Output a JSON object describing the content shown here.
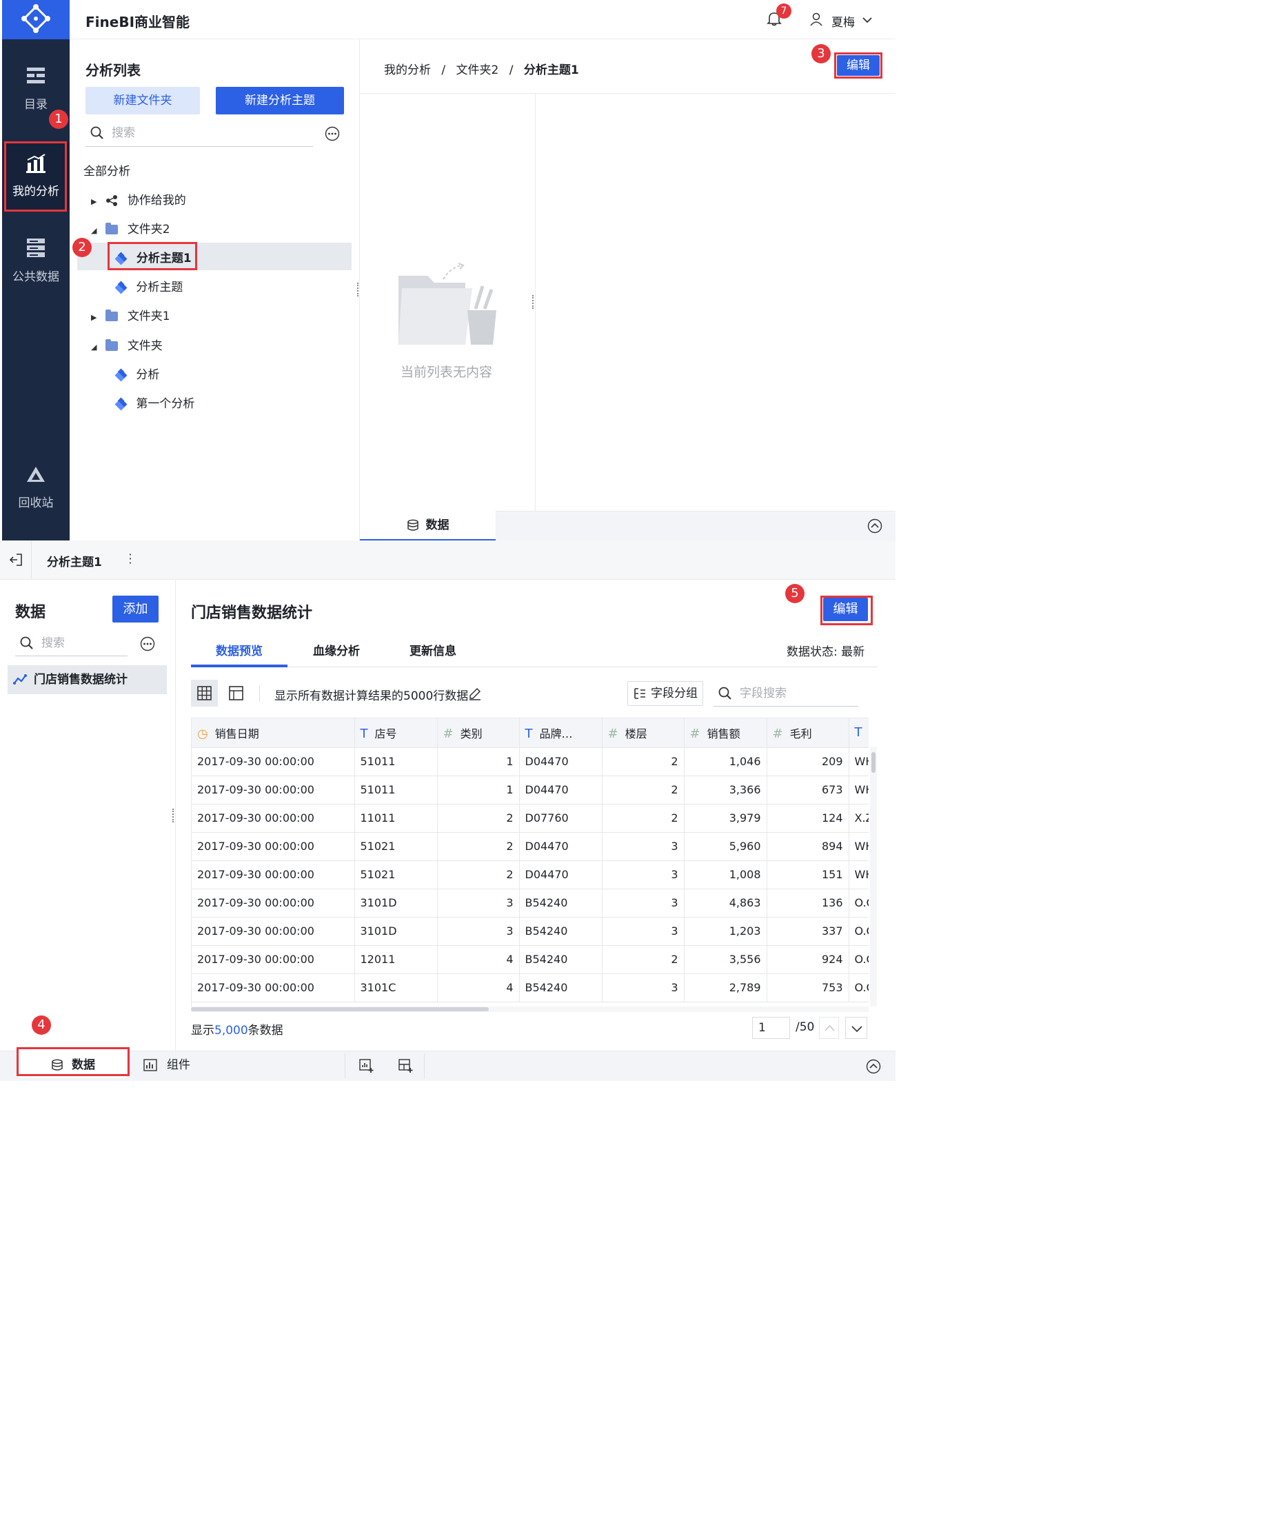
{
  "app": {
    "title": "FineBI商业智能",
    "notification_count": "7",
    "user": "夏梅"
  },
  "sidebar": {
    "items": [
      {
        "label": "目录",
        "icon": "catalog-icon"
      },
      {
        "label": "我的分析",
        "icon": "analysis-icon"
      },
      {
        "label": "公共数据",
        "icon": "public-data-icon"
      },
      {
        "label": "回收站",
        "icon": "recycle-icon"
      }
    ]
  },
  "analysis_list": {
    "title": "分析列表",
    "new_folder": "新建文件夹",
    "new_subject": "新建分析主题",
    "search_placeholder": "搜索",
    "tree": {
      "root": "全部分析",
      "shared": "协作给我的",
      "folder2": "文件夹2",
      "subject1": "分析主题1",
      "subject": "分析主题",
      "folder1": "文件夹1",
      "folder": "文件夹",
      "analysis": "分析",
      "first_analysis": "第一个分析"
    }
  },
  "breadcrumb": {
    "items": [
      "我的分析",
      "文件夹2",
      "分析主题1"
    ],
    "sep": "/"
  },
  "top_edit": "编辑",
  "empty_text": "当前列表无内容",
  "top_data_tab": "数据",
  "subject_bar": {
    "title": "分析主题1",
    "more": "⋮"
  },
  "data_panel": {
    "title": "数据",
    "add": "添加",
    "search_placeholder": "搜索",
    "item": "门店销售数据统计"
  },
  "main": {
    "title": "门店销售数据统计",
    "edit": "编辑",
    "tabs": [
      "数据预览",
      "血缘分析",
      "更新信息"
    ],
    "status_label": "数据状态:",
    "status_value": "最新",
    "info": "显示所有数据计算结果的5000行数据",
    "field_group": "字段分组",
    "field_search_placeholder": "字段搜索"
  },
  "table": {
    "columns": [
      {
        "label": "销售日期",
        "icon": "◷",
        "type": "date"
      },
      {
        "label": "店号",
        "icon": "T",
        "type": "text"
      },
      {
        "label": "类别",
        "icon": "#",
        "type": "num"
      },
      {
        "label": "品牌…",
        "icon": "T",
        "type": "text"
      },
      {
        "label": "楼层",
        "icon": "#",
        "type": "num"
      },
      {
        "label": "销售额",
        "icon": "#",
        "type": "num"
      },
      {
        "label": "毛利",
        "icon": "#",
        "type": "num"
      },
      {
        "label": "",
        "icon": "T",
        "type": "text"
      }
    ],
    "rows": [
      [
        "2017-09-30 00:00:00",
        "51011",
        "1",
        "D04470",
        "2",
        "1,046",
        "209",
        "WH"
      ],
      [
        "2017-09-30 00:00:00",
        "51011",
        "1",
        "D04470",
        "2",
        "3,366",
        "673",
        "WH"
      ],
      [
        "2017-09-30 00:00:00",
        "11011",
        "2",
        "D07760",
        "2",
        "3,979",
        "124",
        "X.Z"
      ],
      [
        "2017-09-30 00:00:00",
        "51021",
        "2",
        "D04470",
        "3",
        "5,960",
        "894",
        "WH"
      ],
      [
        "2017-09-30 00:00:00",
        "51021",
        "2",
        "D04470",
        "3",
        "1,008",
        "151",
        "WH"
      ],
      [
        "2017-09-30 00:00:00",
        "3101D",
        "3",
        "B54240",
        "3",
        "4,863",
        "136",
        "O.C"
      ],
      [
        "2017-09-30 00:00:00",
        "3101D",
        "3",
        "B54240",
        "3",
        "1,203",
        "337",
        "O.C"
      ],
      [
        "2017-09-30 00:00:00",
        "12011",
        "4",
        "B54240",
        "2",
        "3,556",
        "924",
        "O.C"
      ],
      [
        "2017-09-30 00:00:00",
        "3101C",
        "4",
        "B54240",
        "3",
        "2,789",
        "753",
        "O.C"
      ]
    ]
  },
  "footer": {
    "show_prefix": "显示",
    "show_count": "5,000",
    "show_suffix": "条数据",
    "page": "1",
    "page_total": "/50"
  },
  "bottom_bar": {
    "data_tab": "数据",
    "component_tab": "组件"
  },
  "callouts": [
    "1",
    "2",
    "3",
    "4",
    "5"
  ],
  "colors": {
    "accent": "#2c60e5",
    "sidebar": "#1c2943",
    "highlight": "#e5363c"
  }
}
